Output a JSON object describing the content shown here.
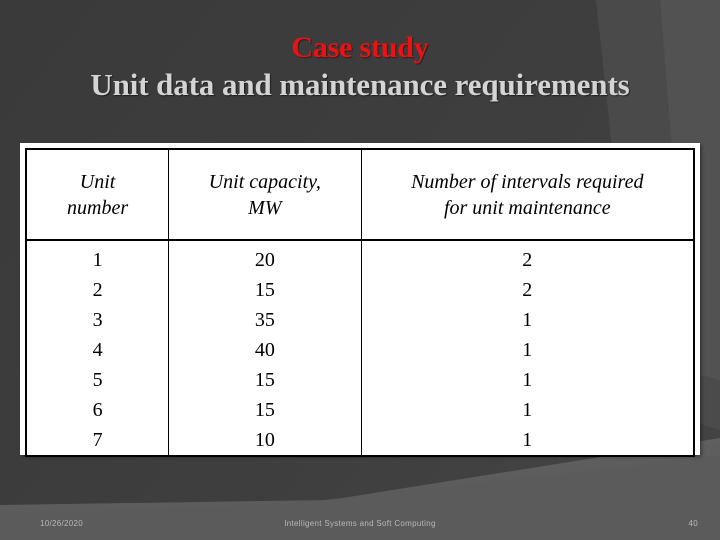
{
  "slide": {
    "title_main": "Case study",
    "title_sub": "Unit data and maintenance requirements",
    "colors": {
      "title_main": "#ee1111",
      "title_sub": "#d4d4d4",
      "background_dark": "#3c3c3c",
      "background_light": "#5e5e5e",
      "table_background": "#ffffff",
      "table_border": "#000000",
      "footer_text": "#b9b9b9"
    }
  },
  "table": {
    "headers": [
      {
        "line1": "Unit",
        "line2": "number"
      },
      {
        "line1": "Unit capacity,",
        "line2": "MW"
      },
      {
        "line1": "Number of intervals required",
        "line2": "for unit maintenance"
      }
    ],
    "rows": [
      {
        "unit_number": "1",
        "unit_capacity_mw": "20",
        "intervals_required": "2"
      },
      {
        "unit_number": "2",
        "unit_capacity_mw": "15",
        "intervals_required": "2"
      },
      {
        "unit_number": "3",
        "unit_capacity_mw": "35",
        "intervals_required": "1"
      },
      {
        "unit_number": "4",
        "unit_capacity_mw": "40",
        "intervals_required": "1"
      },
      {
        "unit_number": "5",
        "unit_capacity_mw": "15",
        "intervals_required": "1"
      },
      {
        "unit_number": "6",
        "unit_capacity_mw": "15",
        "intervals_required": "1"
      },
      {
        "unit_number": "7",
        "unit_capacity_mw": "10",
        "intervals_required": "1"
      }
    ]
  },
  "footer": {
    "date": "10/26/2020",
    "center_text": "Intelligent Systems and Soft Computing",
    "page_number": "40"
  }
}
